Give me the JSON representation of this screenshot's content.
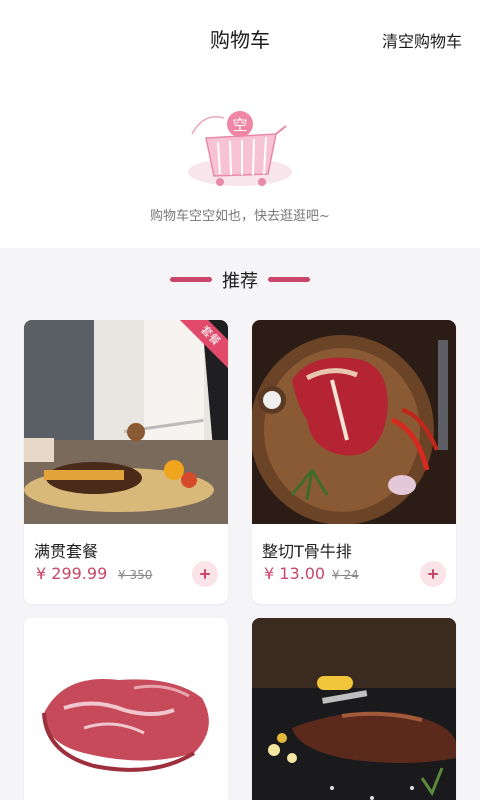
{
  "header": {
    "title": "购物车",
    "clear_label": "清空购物车"
  },
  "empty": {
    "illustration_char": "空",
    "message": "购物车空空如也，快去逛逛吧~"
  },
  "recommend": {
    "title": "推荐"
  },
  "products": [
    {
      "name": "满贯套餐",
      "price": "¥ 299.99",
      "original_price": "¥ 350",
      "tag": "套餐"
    },
    {
      "name": "整切T骨牛排",
      "price": "¥ 13.00",
      "original_price": "¥ 24"
    },
    {
      "name": "",
      "price": "",
      "original_price": ""
    },
    {
      "name": "",
      "price": "",
      "original_price": ""
    }
  ],
  "colors": {
    "accent": "#c8466a",
    "add_bg": "#fbe3ea",
    "background": "#f5f4f6"
  }
}
